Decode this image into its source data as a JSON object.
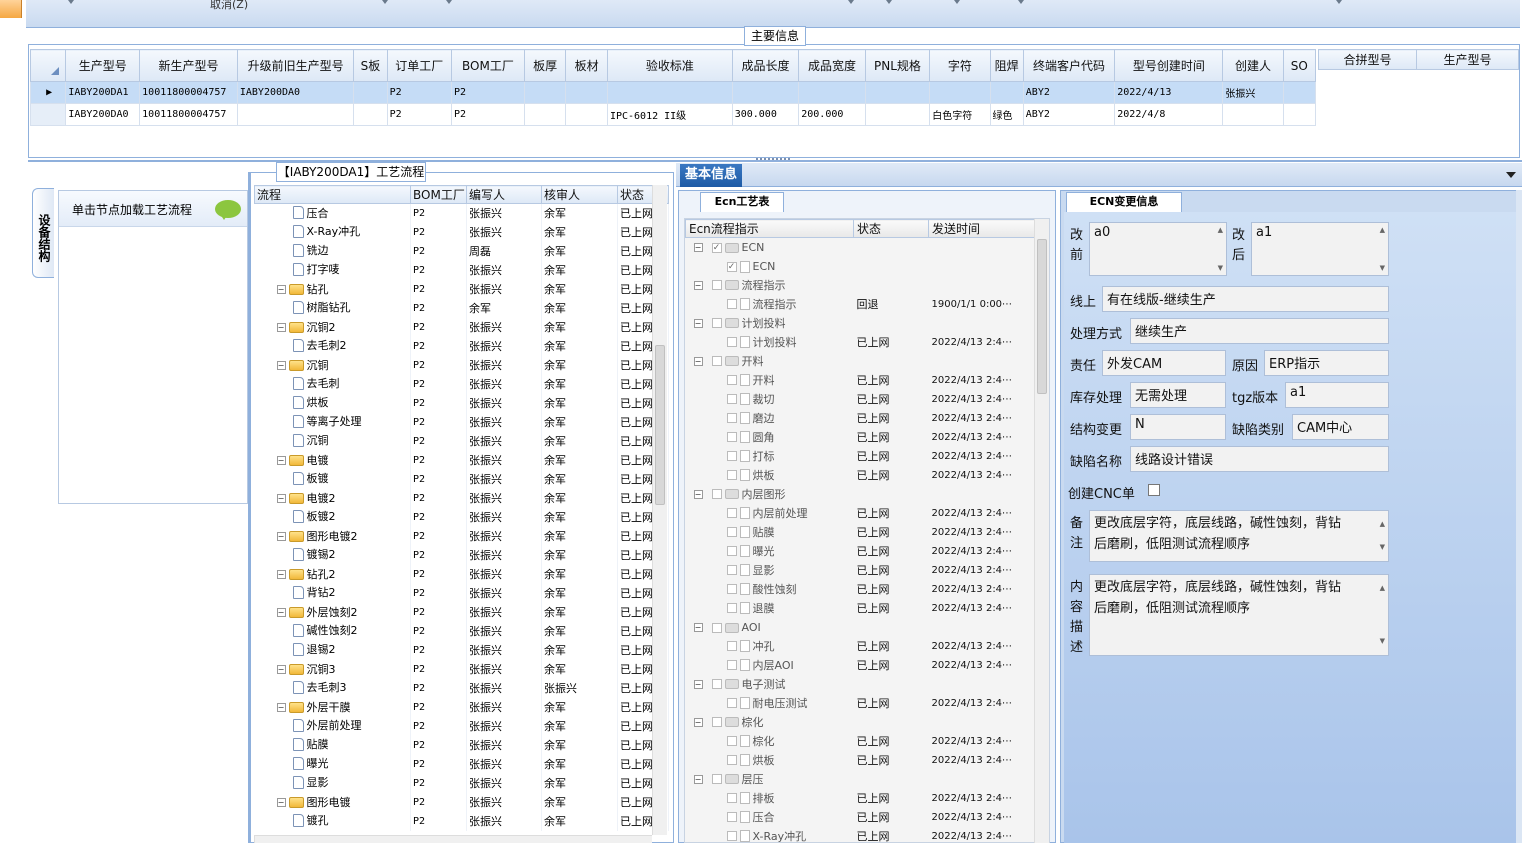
{
  "top": {
    "cancel_label": "取消(Z)"
  },
  "main_info": {
    "title": "主要信息",
    "columns": [
      "生产型号",
      "新生产型号",
      "升级前旧生产型号",
      "S板",
      "订单工厂",
      "BOM工厂",
      "板厚",
      "板材",
      "验收标准",
      "成品长度",
      "成品宽度",
      "PNL规格",
      "字符",
      "阻焊",
      "终端客户代码",
      "型号创建时间",
      "创建人",
      "SO"
    ],
    "rows": [
      [
        "IABY200DA1",
        "10011800004757",
        "IABY200DA0",
        "",
        "P2",
        "P2",
        "",
        "",
        "",
        "",
        "",
        "",
        "",
        "",
        "ABY2",
        "2022/4/13",
        "张振兴",
        ""
      ],
      [
        "IABY200DA0",
        "10011800004757",
        "",
        "",
        "P2",
        "P2",
        "",
        "",
        "IPC-6012 II级",
        "300.000",
        "200.000",
        "",
        "白色字符",
        "绿色",
        "ABY2",
        "2022/4/8",
        "",
        ""
      ]
    ],
    "merge_columns": [
      "合拼型号",
      "生产型号"
    ]
  },
  "device_tab_label": "设备结构",
  "left_tree": {
    "hint": "单击节点加载工艺流程"
  },
  "route": {
    "title": "【IABY200DA1】工艺流程",
    "columns": [
      "流程",
      "BOM工厂",
      "编写人",
      "核审人",
      "状态"
    ],
    "rows": [
      {
        "name": "压合",
        "level": 2,
        "bom": "P2",
        "writer": "张振兴",
        "checker": "余军",
        "status": "已上网"
      },
      {
        "name": "X-Ray冲孔",
        "level": 2,
        "bom": "P2",
        "writer": "张振兴",
        "checker": "余军",
        "status": "已上网"
      },
      {
        "name": "铣边",
        "level": 2,
        "bom": "P2",
        "writer": "周磊",
        "checker": "余军",
        "status": "已上网"
      },
      {
        "name": "打字唛",
        "level": 2,
        "bom": "P2",
        "writer": "张振兴",
        "checker": "余军",
        "status": "已上网"
      },
      {
        "name": "钻孔",
        "level": 1,
        "bom": "P2",
        "writer": "张振兴",
        "checker": "余军",
        "status": "已上网"
      },
      {
        "name": "树脂钻孔",
        "level": 2,
        "bom": "P2",
        "writer": "余军",
        "checker": "余军",
        "status": "已上网"
      },
      {
        "name": "沉铜2",
        "level": 1,
        "bom": "P2",
        "writer": "张振兴",
        "checker": "余军",
        "status": "已上网"
      },
      {
        "name": "去毛刺2",
        "level": 2,
        "bom": "P2",
        "writer": "张振兴",
        "checker": "余军",
        "status": "已上网"
      },
      {
        "name": "沉铜",
        "level": 1,
        "bom": "P2",
        "writer": "张振兴",
        "checker": "余军",
        "status": "已上网"
      },
      {
        "name": "去毛刺",
        "level": 2,
        "bom": "P2",
        "writer": "张振兴",
        "checker": "余军",
        "status": "已上网"
      },
      {
        "name": "烘板",
        "level": 2,
        "bom": "P2",
        "writer": "张振兴",
        "checker": "余军",
        "status": "已上网"
      },
      {
        "name": "等离子处理",
        "level": 2,
        "bom": "P2",
        "writer": "张振兴",
        "checker": "余军",
        "status": "已上网"
      },
      {
        "name": "沉铜",
        "level": 2,
        "bom": "P2",
        "writer": "张振兴",
        "checker": "余军",
        "status": "已上网"
      },
      {
        "name": "电镀",
        "level": 1,
        "bom": "P2",
        "writer": "张振兴",
        "checker": "余军",
        "status": "已上网"
      },
      {
        "name": "板镀",
        "level": 2,
        "bom": "P2",
        "writer": "张振兴",
        "checker": "余军",
        "status": "已上网"
      },
      {
        "name": "电镀2",
        "level": 1,
        "bom": "P2",
        "writer": "张振兴",
        "checker": "余军",
        "status": "已上网"
      },
      {
        "name": "板镀2",
        "level": 2,
        "bom": "P2",
        "writer": "张振兴",
        "checker": "余军",
        "status": "已上网"
      },
      {
        "name": "图形电镀2",
        "level": 1,
        "bom": "P2",
        "writer": "张振兴",
        "checker": "余军",
        "status": "已上网"
      },
      {
        "name": "镀锡2",
        "level": 2,
        "bom": "P2",
        "writer": "张振兴",
        "checker": "余军",
        "status": "已上网"
      },
      {
        "name": "钻孔2",
        "level": 1,
        "bom": "P2",
        "writer": "张振兴",
        "checker": "余军",
        "status": "已上网"
      },
      {
        "name": "背钻2",
        "level": 2,
        "bom": "P2",
        "writer": "张振兴",
        "checker": "余军",
        "status": "已上网"
      },
      {
        "name": "外层蚀刻2",
        "level": 1,
        "bom": "P2",
        "writer": "张振兴",
        "checker": "余军",
        "status": "已上网"
      },
      {
        "name": "碱性蚀刻2",
        "level": 2,
        "bom": "P2",
        "writer": "张振兴",
        "checker": "余军",
        "status": "已上网"
      },
      {
        "name": "退锡2",
        "level": 2,
        "bom": "P2",
        "writer": "张振兴",
        "checker": "余军",
        "status": "已上网"
      },
      {
        "name": "沉铜3",
        "level": 1,
        "bom": "P2",
        "writer": "张振兴",
        "checker": "余军",
        "status": "已上网"
      },
      {
        "name": "去毛刺3",
        "level": 2,
        "bom": "P2",
        "writer": "张振兴",
        "checker": "张振兴",
        "status": "已上网"
      },
      {
        "name": "外层干膜",
        "level": 1,
        "bom": "P2",
        "writer": "张振兴",
        "checker": "余军",
        "status": "已上网"
      },
      {
        "name": "外层前处理",
        "level": 2,
        "bom": "P2",
        "writer": "张振兴",
        "checker": "余军",
        "status": "已上网"
      },
      {
        "name": "贴膜",
        "level": 2,
        "bom": "P2",
        "writer": "张振兴",
        "checker": "余军",
        "status": "已上网"
      },
      {
        "name": "曝光",
        "level": 2,
        "bom": "P2",
        "writer": "张振兴",
        "checker": "余军",
        "status": "已上网"
      },
      {
        "name": "显影",
        "level": 2,
        "bom": "P2",
        "writer": "张振兴",
        "checker": "余军",
        "status": "已上网"
      },
      {
        "name": "图形电镀",
        "level": 1,
        "bom": "P2",
        "writer": "张振兴",
        "checker": "余军",
        "status": "已上网"
      },
      {
        "name": "镀孔",
        "level": 2,
        "bom": "P2",
        "writer": "张振兴",
        "checker": "余军",
        "status": "已上网"
      }
    ]
  },
  "basic_info_tab": "基本信息",
  "ecn_tab": "Ecn工艺表",
  "ecn": {
    "columns": [
      "Ecn流程指示",
      "状态",
      "发送时间"
    ],
    "rows": [
      {
        "name": "ECN",
        "level": 0,
        "folder": true,
        "checked": true,
        "status": "",
        "time": ""
      },
      {
        "name": "ECN",
        "level": 1,
        "folder": false,
        "checked": true,
        "status": "",
        "time": ""
      },
      {
        "name": "流程指示",
        "level": 0,
        "folder": true,
        "checked": false,
        "status": "",
        "time": ""
      },
      {
        "name": "流程指示",
        "level": 1,
        "folder": false,
        "checked": false,
        "status": "回退",
        "time": "1900/1/1 0:00⋯"
      },
      {
        "name": "计划投料",
        "level": 0,
        "folder": true,
        "checked": false,
        "status": "",
        "time": ""
      },
      {
        "name": "计划投料",
        "level": 1,
        "folder": false,
        "checked": false,
        "status": "已上网",
        "time": "2022/4/13 2:4⋯"
      },
      {
        "name": "开料",
        "level": 0,
        "folder": true,
        "checked": false,
        "status": "",
        "time": ""
      },
      {
        "name": "开料",
        "level": 1,
        "folder": false,
        "checked": false,
        "status": "已上网",
        "time": "2022/4/13 2:4⋯"
      },
      {
        "name": "裁切",
        "level": 1,
        "folder": false,
        "checked": false,
        "status": "已上网",
        "time": "2022/4/13 2:4⋯"
      },
      {
        "name": "磨边",
        "level": 1,
        "folder": false,
        "checked": false,
        "status": "已上网",
        "time": "2022/4/13 2:4⋯"
      },
      {
        "name": "圆角",
        "level": 1,
        "folder": false,
        "checked": false,
        "status": "已上网",
        "time": "2022/4/13 2:4⋯"
      },
      {
        "name": "打标",
        "level": 1,
        "folder": false,
        "checked": false,
        "status": "已上网",
        "time": "2022/4/13 2:4⋯"
      },
      {
        "name": "烘板",
        "level": 1,
        "folder": false,
        "checked": false,
        "status": "已上网",
        "time": "2022/4/13 2:4⋯"
      },
      {
        "name": "内层图形",
        "level": 0,
        "folder": true,
        "checked": false,
        "status": "",
        "time": ""
      },
      {
        "name": "内层前处理",
        "level": 1,
        "folder": false,
        "checked": false,
        "status": "已上网",
        "time": "2022/4/13 2:4⋯"
      },
      {
        "name": "贴膜",
        "level": 1,
        "folder": false,
        "checked": false,
        "status": "已上网",
        "time": "2022/4/13 2:4⋯"
      },
      {
        "name": "曝光",
        "level": 1,
        "folder": false,
        "checked": false,
        "status": "已上网",
        "time": "2022/4/13 2:4⋯"
      },
      {
        "name": "显影",
        "level": 1,
        "folder": false,
        "checked": false,
        "status": "已上网",
        "time": "2022/4/13 2:4⋯"
      },
      {
        "name": "酸性蚀刻",
        "level": 1,
        "folder": false,
        "checked": false,
        "status": "已上网",
        "time": "2022/4/13 2:4⋯"
      },
      {
        "name": "退膜",
        "level": 1,
        "folder": false,
        "checked": false,
        "status": "已上网",
        "time": "2022/4/13 2:4⋯"
      },
      {
        "name": "AOI",
        "level": 0,
        "folder": true,
        "checked": false,
        "status": "",
        "time": ""
      },
      {
        "name": "冲孔",
        "level": 1,
        "folder": false,
        "checked": false,
        "status": "已上网",
        "time": "2022/4/13 2:4⋯"
      },
      {
        "name": "内层AOI",
        "level": 1,
        "folder": false,
        "checked": false,
        "status": "已上网",
        "time": "2022/4/13 2:4⋯"
      },
      {
        "name": "电子测试",
        "level": 0,
        "folder": true,
        "checked": false,
        "status": "",
        "time": ""
      },
      {
        "name": "耐电压测试",
        "level": 1,
        "folder": false,
        "checked": false,
        "status": "已上网",
        "time": "2022/4/13 2:4⋯"
      },
      {
        "name": "棕化",
        "level": 0,
        "folder": true,
        "checked": false,
        "status": "",
        "time": ""
      },
      {
        "name": "棕化",
        "level": 1,
        "folder": false,
        "checked": false,
        "status": "已上网",
        "time": "2022/4/13 2:4⋯"
      },
      {
        "name": "烘板",
        "level": 1,
        "folder": false,
        "checked": false,
        "status": "已上网",
        "time": "2022/4/13 2:4⋯"
      },
      {
        "name": "层压",
        "level": 0,
        "folder": true,
        "checked": false,
        "status": "",
        "time": ""
      },
      {
        "name": "排板",
        "level": 1,
        "folder": false,
        "checked": false,
        "status": "已上网",
        "time": "2022/4/13 2:4⋯"
      },
      {
        "name": "压合",
        "level": 1,
        "folder": false,
        "checked": false,
        "status": "已上网",
        "time": "2022/4/13 2:4⋯"
      },
      {
        "name": "X-Ray冲孔",
        "level": 1,
        "folder": false,
        "checked": false,
        "status": "已上网",
        "time": "2022/4/13 2:4⋯"
      }
    ]
  },
  "ecn_change_tab": "ECN变更信息",
  "change": {
    "before_label": "改前",
    "before_value": "a0",
    "after_label": "改后",
    "after_value": "a1",
    "online_label": "线上",
    "online_value": "有在线版-继续生产",
    "method_label": "处理方式",
    "method_value": "继续生产",
    "duty_label": "责任",
    "duty_value": "外发CAM",
    "reason_label": "原因",
    "reason_value": "ERP指示",
    "stock_label": "库存处理",
    "stock_value": "无需处理",
    "tgz_label": "tgz版本",
    "tgz_value": "a1",
    "struct_label": "结构变更",
    "struct_value": "N",
    "defect_type_label": "缺陷类别",
    "defect_type_value": "CAM中心",
    "defect_name_label": "缺陷名称",
    "defect_name_value": "线路设计错误",
    "cnc_label": "创建CNC单",
    "remark_label": "备注",
    "remark_value": "更改底层字符，底层线路，碱性蚀刻，背钻\n后磨刷，低阻测试流程顺序",
    "content_label": "内容描述",
    "content_value": "更改底层字符，底层线路，碱性蚀刻，背钻\n后磨刷，低阻测试流程顺序"
  }
}
